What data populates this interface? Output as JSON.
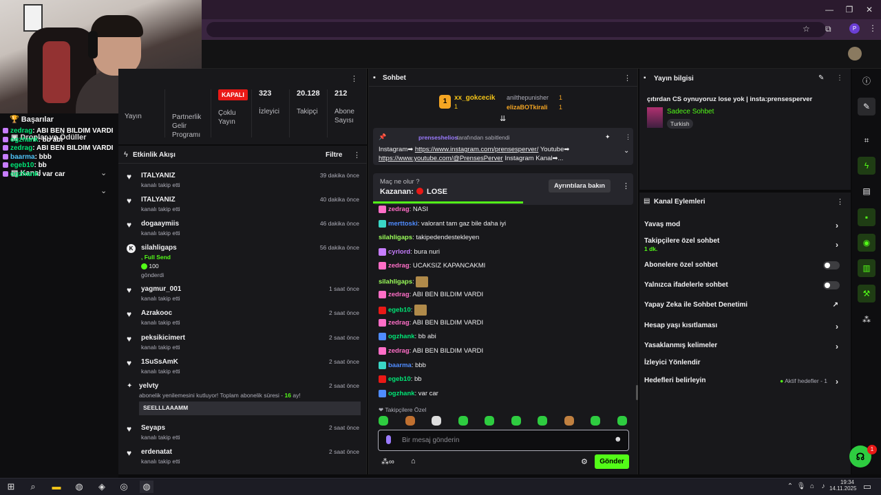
{
  "browser": {
    "profile_initial": "P"
  },
  "left": {
    "achievements": "Başarılar",
    "drops": "Droplar ve Ödüller",
    "channel": "Kanal",
    "overlay": [
      {
        "user": "zedrag",
        "msg": ": ABI BEN BILDIM VARDI",
        "color": "#00e676"
      },
      {
        "user": "ogzhank",
        "msg": ": bb abi",
        "color": "#00e676"
      },
      {
        "user": "zedrag",
        "msg": ": ABI BEN BILDIM VARDI",
        "color": "#00e676"
      },
      {
        "user": "baarma",
        "msg": ": bbb",
        "color": "#4fc3f7"
      },
      {
        "user": "egeb10",
        "msg": ": bb",
        "color": "#00e676"
      },
      {
        "user": "ogzhank",
        "msg": ": var car",
        "color": "#00e676"
      }
    ]
  },
  "stats": {
    "yayin": "Yayın",
    "partner": "Partnerlik Gelir Programı",
    "coklu_badge": "KAPALI",
    "coklu": "Çoklu Yayın",
    "viewers_num": "323",
    "viewers": "İzleyici",
    "followers_num": "20.128",
    "followers": "Takipçi",
    "subs_num": "212",
    "subs": "Abone Sayısı"
  },
  "feed": {
    "title": "Etkinlik Akışı",
    "filter": "Filtre",
    "items": [
      {
        "name": "ITALYANIZ",
        "sub": "kanalı takip etti",
        "time": "39 dakika önce"
      },
      {
        "name": "ITALYANIZ",
        "sub": "kanalı takip etti",
        "time": "40 dakika önce"
      },
      {
        "name": "dogaaymiis",
        "sub": "kanalı takip etti",
        "time": "46 dakika önce"
      },
      {
        "name": "silahligaps",
        "sub": "gönderdi",
        "extra": ", Full Send",
        "amount": "100",
        "time": "56 dakika önce"
      },
      {
        "name": "yagmur_001",
        "sub": "kanalı takip etti",
        "time": "1 saat önce"
      },
      {
        "name": "Azrakooc",
        "sub": "kanalı takip etti",
        "time": "2 saat önce"
      },
      {
        "name": "peksikicimert",
        "sub": "kanalı takip etti",
        "time": "2 saat önce"
      },
      {
        "name": "1SuSsAmK",
        "sub": "kanalı takip etti",
        "time": "2 saat önce"
      },
      {
        "name": "yelvty",
        "sub": "abonelik yenilemesini kutluyor! Toplam abonelik süresi - ",
        "months": "16",
        "months_unit": " ay!",
        "msg": "SEELLLAAAMM",
        "time": "2 saat önce"
      },
      {
        "name": "Seyaps",
        "sub": "kanalı takip etti",
        "time": "2 saat önce"
      },
      {
        "name": "erdenatat",
        "sub": "kanalı takip etti",
        "time": "2 saat önce"
      }
    ]
  },
  "chat": {
    "title": "Sohbet",
    "top": [
      {
        "name": "xx_gokcecik",
        "count": "1"
      },
      {
        "name": "anilthepunisher",
        "count": "1"
      },
      {
        "name": "elizaBOTkirali",
        "count": "1"
      }
    ],
    "pinned_by": "prenseshelios",
    "pinned_by_suffix": " tarafından sabitlendi",
    "pinned_text1": "Instagram➡ ",
    "pinned_link1": "https://www.instagram.com/prensesperver/",
    "pinned_text2": " Youtube➡",
    "pinned_link2": "https://www.youtube.com/@PrensesPerver",
    "pinned_text3": " Instagram Kanal➡...",
    "bet_q": "Maç ne olur ?",
    "bet_winner_label": "Kazanan:",
    "bet_winner": "LOSE",
    "bet_details": "Ayrıntılara bakın",
    "messages": [
      {
        "user": "zedrag",
        "color": "#ff6ec7",
        "msg": ": NASI"
      },
      {
        "user": "merttoski",
        "color": "#4f8cff",
        "msg": ": valorant tam gaz bile daha iyi"
      },
      {
        "user": "silahligaps",
        "color": "#9bff5a",
        "msg": ": takipedendestekleyen"
      },
      {
        "user": "cyrlord",
        "color": "#c77dff",
        "msg": ": bura nuri"
      },
      {
        "user": "zedrag",
        "color": "#ff6ec7",
        "msg": ": UCAKSIZ KAPANCAKMI"
      },
      {
        "user": "silahligaps",
        "color": "#9bff5a",
        "msg": ":"
      },
      {
        "user": "zedrag",
        "color": "#ff6ec7",
        "msg": ": ABI BEN BILDIM VARDI"
      },
      {
        "user": "egeb10",
        "color": "#00e676",
        "msg": ":"
      },
      {
        "user": "zedrag",
        "color": "#ff6ec7",
        "msg": ": ABI BEN BILDIM VARDI"
      },
      {
        "user": "ogzhank",
        "color": "#00e676",
        "msg": ": bb abi"
      },
      {
        "user": "zedrag",
        "color": "#ff6ec7",
        "msg": ": ABI BEN BILDIM VARDI"
      },
      {
        "user": "baarma",
        "color": "#4f8cff",
        "msg": ": bbb"
      },
      {
        "user": "egeb10",
        "color": "#00e676",
        "msg": ": bb"
      },
      {
        "user": "ogzhank",
        "color": "#00e676",
        "msg": ": var car"
      }
    ],
    "followers_only": "Takipçilere Özel",
    "placeholder": "Bir mesaj gönderin",
    "send": "Gönder"
  },
  "info": {
    "title": "Yayın bilgisi",
    "stream_title": "çıtırdan CS oynuyoruz lose yok | insta:prensesperver",
    "category": "Sadece Sohbet",
    "tag": "Turkish"
  },
  "actions": {
    "title": "Kanal Eylemleri",
    "slow": "Yavaş mod",
    "followers": "Takipçilere özel sohbet",
    "followers_sub": "1 dk.",
    "subs": "Abonelere özel sohbet",
    "emote": "Yalnızca ifadelerle sohbet",
    "ai": "Yapay Zeka ile Sohbet Denetimi",
    "age": "Hesap yaşı kısıtlaması",
    "banned": "Yasaklanmış kelimeler",
    "redirect": "İzleyici Yönlendir",
    "goals": "Hedefleri belirleyin",
    "goals_status": "Aktif hedefler - 1"
  },
  "taskbar": {
    "time": "19:34",
    "date": "14.11.2025"
  },
  "colors": {
    "accent": "#53fc18",
    "red": "#e91916",
    "panel": "#18181b"
  }
}
